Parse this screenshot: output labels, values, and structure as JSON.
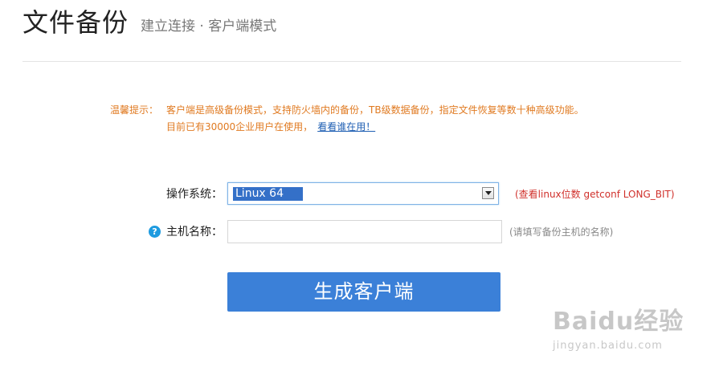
{
  "header": {
    "title": "文件备份",
    "subtitle": "建立连接 · 客户端模式"
  },
  "tip": {
    "label": "温馨提示：",
    "line1": "客户端是高级备份模式，支持防火墙内的备份，TB级数据备份，指定文件恢复等数十种高级功能。",
    "line2": "目前已有30000企业用户在使用，",
    "link": "看看谁在用！"
  },
  "form": {
    "os": {
      "label": "操作系统：",
      "value": "Linux 64",
      "hint": "(查看linux位数 getconf LONG_BIT)"
    },
    "host": {
      "label": "主机名称：",
      "value": "",
      "hint": "(请填写备份主机的名称)",
      "help_icon": "question-circle-icon"
    },
    "submit_label": "生成客户端"
  },
  "watermark": {
    "logo": "Baidu经验",
    "url": "jingyan.baidu.com"
  },
  "colors": {
    "accent": "#3b80d8",
    "tip": "#e07a21",
    "error": "#d0302b",
    "link": "#1f5fb3"
  }
}
